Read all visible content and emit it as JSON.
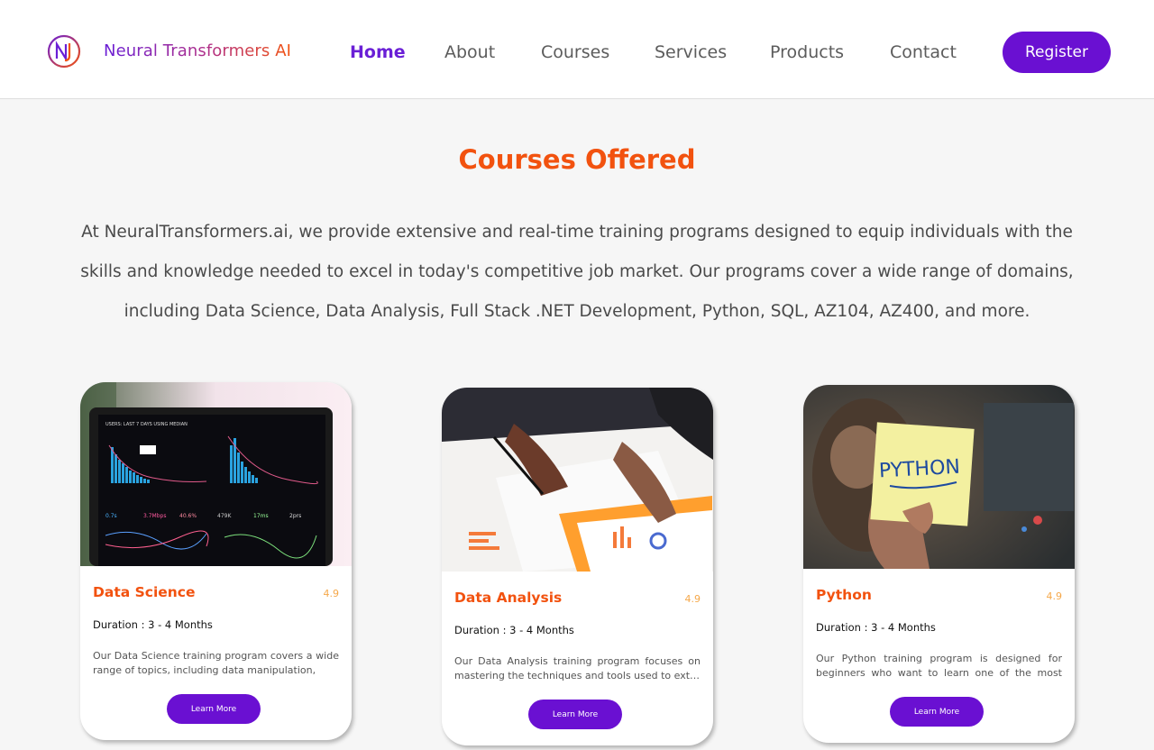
{
  "brand": {
    "name": "Neural Transformers AI",
    "accent": "#6a10d2",
    "orange": "#f2520f"
  },
  "nav": {
    "items": [
      {
        "label": "Home",
        "active": true
      },
      {
        "label": "About"
      },
      {
        "label": "Courses"
      },
      {
        "label": "Services"
      },
      {
        "label": "Products"
      },
      {
        "label": "Contact"
      }
    ],
    "register_label": "Register"
  },
  "section": {
    "title": "Courses Offered",
    "description": "At NeuralTransformers.ai, we provide extensive and real-time training programs designed to equip individuals with the skills and knowledge needed to excel in today's competitive job market. Our programs cover a wide range of domains, including Data Science, Data Analysis, Full Stack .NET Development, Python, SQL, AZ104, AZ400, and more."
  },
  "courses": [
    {
      "title": "Data Science",
      "rating": "4.9",
      "duration": "Duration : 3 - 4 Months",
      "description": "Our Data Science training program covers a wide range of topics, including data manipulation,",
      "button": "Learn More",
      "image": "laptop-analytics-dashboard"
    },
    {
      "title": "Data Analysis",
      "rating": "4.9",
      "duration": "Duration : 3 - 4 Months",
      "description": "Our Data Analysis training program focuses on mastering the techniques and tools used to ext…",
      "button": "Learn More",
      "image": "hands-with-charts-on-paper"
    },
    {
      "title": "Python",
      "rating": "4.9",
      "duration": "Duration : 3 - 4 Months",
      "description": "Our Python training program is designed for beginners who want to learn one of the most po…",
      "button": "Learn More",
      "image": "python-sticky-note",
      "image_text": "PYTHON"
    }
  ]
}
